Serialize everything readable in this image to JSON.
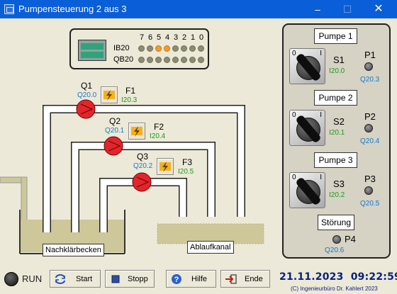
{
  "window": {
    "title": "Pumpensteuerung 2 aus 3",
    "minimize": "–",
    "maximize": "☐",
    "close": "✕"
  },
  "plc": {
    "input_row_label": "IB20",
    "output_row_label": "QB20",
    "bit_numbers": [
      "7",
      "6",
      "5",
      "4",
      "3",
      "2",
      "1",
      "0"
    ],
    "input_bits_on": [
      0,
      0,
      1,
      1,
      0,
      0,
      0,
      0
    ],
    "output_bits_on": [
      0,
      0,
      0,
      0,
      0,
      0,
      0,
      0
    ],
    "colors": {
      "led_on": "#f39c2b",
      "led_off": "#8c8c72"
    }
  },
  "pumps": [
    {
      "name": "Q1",
      "output_address": "Q20.0",
      "fuse": "F1",
      "fuse_address": "I20.3"
    },
    {
      "name": "Q2",
      "output_address": "Q20.1",
      "fuse": "F2",
      "fuse_address": "I20.4"
    },
    {
      "name": "Q3",
      "output_address": "Q20.2",
      "fuse": "F3",
      "fuse_address": "I20.5"
    }
  ],
  "tanks": {
    "left": "Nachklärbecken",
    "right": "Ablaufkanal"
  },
  "panel": {
    "sections": [
      {
        "button": "Pumpe 1",
        "switch_label": "S1",
        "switch_address": "I20.0",
        "lamp_label": "P1",
        "lamp_address": "Q20.3"
      },
      {
        "button": "Pumpe 2",
        "switch_label": "S2",
        "switch_address": "I20.1",
        "lamp_label": "P2",
        "lamp_address": "Q20.4"
      },
      {
        "button": "Pumpe 3",
        "switch_label": "S3",
        "switch_address": "I20.2",
        "lamp_label": "P3",
        "lamp_address": "Q20.5"
      }
    ],
    "switch_marks": {
      "off": "0",
      "on": "I"
    },
    "fault": {
      "button": "Störung",
      "lamp_label": "P4",
      "lamp_address": "Q20.6"
    }
  },
  "toolbar": {
    "run_label": "RUN",
    "start_label": "Start",
    "stop_label": "Stopp",
    "help_label": "Hilfe",
    "exit_label": "Ende"
  },
  "status": {
    "date": "21.11.2023",
    "time": "09:22:59",
    "copyright": "(C) Ingenieurbüro Dr. Kahlert 2023"
  },
  "icons": {
    "app": "window-icon",
    "fuse": "lightning-icon",
    "start": "cycle-arrows-icon",
    "stop": "stop-square-icon",
    "help": "question-icon",
    "exit": "exit-arrow-icon"
  },
  "colors": {
    "titlebar": "#0A5ED7",
    "background": "#ECE9D8",
    "pump": "#e0262c",
    "water": "#cdc79a",
    "address_blue": "#1678c8",
    "address_green": "#1a9a1a",
    "datetime": "#0b1f7a"
  }
}
